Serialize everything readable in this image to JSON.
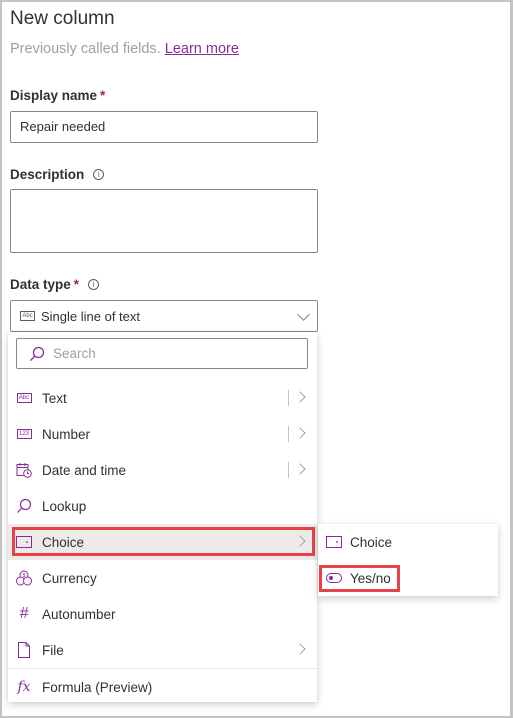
{
  "header": {
    "title": "New column",
    "subtitle": "Previously called fields.",
    "learn_more": "Learn more"
  },
  "display_name": {
    "label": "Display name",
    "required_mark": "*",
    "value": "Repair needed"
  },
  "description": {
    "label": "Description",
    "info_icon": "info-icon",
    "value": ""
  },
  "data_type": {
    "label": "Data type",
    "required_mark": "*",
    "info_icon": "info-icon",
    "selected_icon": "text-abc-icon",
    "selected": "Single line of text"
  },
  "menu": {
    "search_placeholder": "Search",
    "items": [
      {
        "label": "Text",
        "icon": "text-abc-icon",
        "has_submenu": true
      },
      {
        "label": "Number",
        "icon": "number-123-icon",
        "has_submenu": true
      },
      {
        "label": "Date and time",
        "icon": "calendar-clock-icon",
        "has_submenu": true
      },
      {
        "label": "Lookup",
        "icon": "search-icon",
        "has_submenu": false
      },
      {
        "label": "Choice",
        "icon": "choice-icon",
        "has_submenu": true,
        "selected": true
      },
      {
        "label": "Currency",
        "icon": "currency-icon",
        "has_submenu": false
      },
      {
        "label": "Autonumber",
        "icon": "hash-icon",
        "has_submenu": false
      },
      {
        "label": "File",
        "icon": "file-icon",
        "has_submenu": true
      },
      {
        "label": "Formula (Preview)",
        "icon": "fx-icon",
        "has_submenu": false
      }
    ],
    "fx_glyph": "fx",
    "hash_glyph": "#"
  },
  "submenu": {
    "items": [
      {
        "label": "Choice",
        "icon": "choice-icon"
      },
      {
        "label": "Yes/no",
        "icon": "toggle-icon",
        "highlighted": true
      }
    ]
  },
  "colors": {
    "accent": "#8a2b9b",
    "highlight_box": "#e8414a",
    "required": "#a4262c"
  }
}
